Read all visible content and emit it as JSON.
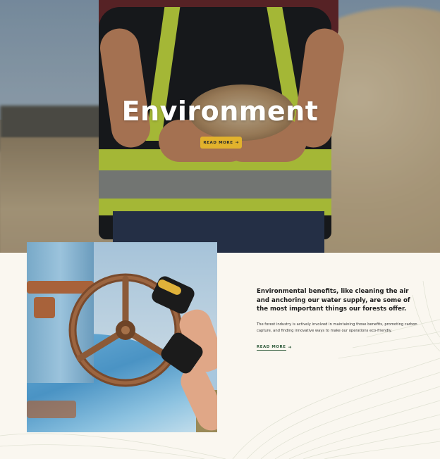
{
  "hero": {
    "title": "Environment",
    "button_label": "READ MORE",
    "button_color": "#e2b22c"
  },
  "feature": {
    "lead": "Environmental benefits, like cleaning the air and anchoring our water supply, are some of the most important things our forests offer.",
    "body": "The forest industry is actively involved in maintaining those benefits, promoting carbon capture, and finding innovative ways to make our operations eco-friendly.",
    "link_label": "READ MORE",
    "link_color": "#2e5a3a"
  },
  "icons": {
    "hero_button_arrow": "arrow-right-icon",
    "link_arrow": "arrow-right-icon"
  },
  "colors": {
    "background": "#faf7f0",
    "topo_lines": "#d8dccb"
  }
}
